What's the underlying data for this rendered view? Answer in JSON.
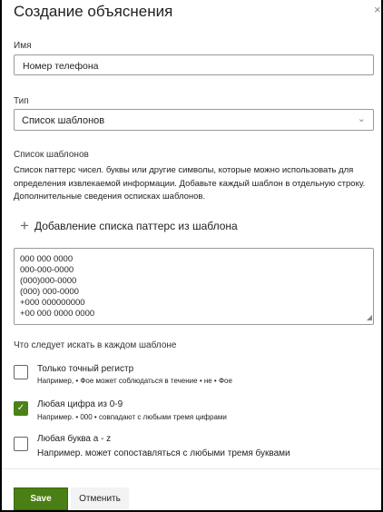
{
  "dialog": {
    "title": "Создание объяснения",
    "close": "×"
  },
  "name": {
    "label": "Имя",
    "value": "Номер телефона"
  },
  "type": {
    "label": "Тип",
    "value": "Список шаблонов"
  },
  "patterns": {
    "label": "Список шаблонов",
    "description": "Список паттерс чисел. буквы или другие символы, которые можно использовать для определения извлекаемой информации. Добавьте каждый шаблон в отдельную строку. Дополнительные сведения осписках шаблонов.",
    "add_label": "Добавление списка паттерс из шаблона",
    "lines": [
      "000 000 0000",
      "000-000-0000",
      "(000)000-0000",
      "(000) 000-0000",
      "+000 000000000",
      "+00 000 0000 0000"
    ]
  },
  "options": {
    "label": "Что следует искать в каждом шаблоне",
    "items": [
      {
        "title": "Только точный регистр",
        "sub": "Например, • Фое может соблюдаться в течение • не • Фое",
        "checked": false
      },
      {
        "title": "Любая цифра из 0-9",
        "sub": "Например. • 000 • совпадают с любыми тремя цифрами",
        "checked": true
      },
      {
        "title": "Любая буква a - z",
        "sub": "Например. может сопоставляться с любыми тремя буквами",
        "checked": false
      }
    ]
  },
  "footer": {
    "save": "Save",
    "cancel": "Отменить"
  },
  "colors": {
    "accent": "#4a7f15"
  }
}
